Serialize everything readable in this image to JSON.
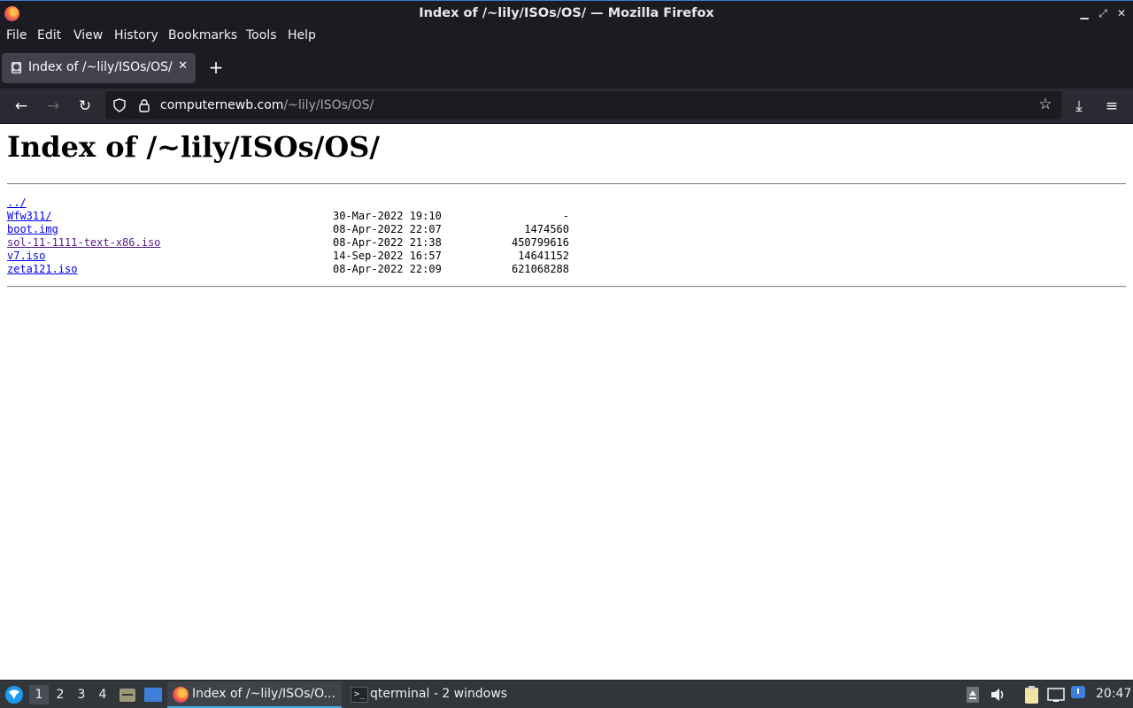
{
  "window": {
    "title": "Index of /~lily/ISOs/OS/ — Mozilla Firefox",
    "minimize": "▁",
    "restore": "⤢",
    "close": "✕"
  },
  "menu": [
    "File",
    "Edit",
    "View",
    "History",
    "Bookmarks",
    "Tools",
    "Help"
  ],
  "tab": {
    "label": "Index of /~lily/ISOs/OS/",
    "close": "✕",
    "new_tab": "+"
  },
  "nav": {
    "back": "←",
    "forward": "→",
    "reload": "↻",
    "url_domain": "computernewb.com",
    "url_path": "/~lily/ISOs/OS/",
    "bookmark": "☆",
    "downloads": "⤓",
    "menu": "≡"
  },
  "page": {
    "heading": "Index of /~lily/ISOs/OS/",
    "parent": "../",
    "entries": [
      {
        "name": "Wfw311/",
        "date": "30-Mar-2022 19:10",
        "size": "-",
        "visited": false
      },
      {
        "name": "boot.img",
        "date": "08-Apr-2022 22:07",
        "size": "1474560",
        "visited": false
      },
      {
        "name": "sol-11-1111-text-x86.iso",
        "date": "08-Apr-2022 21:38",
        "size": "450799616",
        "visited": true
      },
      {
        "name": "v7.iso",
        "date": "14-Sep-2022 16:57",
        "size": "14641152",
        "visited": false
      },
      {
        "name": "zeta121.iso",
        "date": "08-Apr-2022 22:09",
        "size": "621068288",
        "visited": false
      }
    ]
  },
  "taskbar": {
    "workspaces": [
      "1",
      "2",
      "3",
      "4"
    ],
    "tasks": [
      {
        "label": "Index of /~lily/ISOs/O...",
        "icon": "firefox-icon"
      },
      {
        "label": "qterminal - 2 windows",
        "icon": "terminal-icon"
      }
    ],
    "clock": "20:47"
  },
  "colors": {
    "chrome_dark": "#1c1b22",
    "navbar": "#2b2a33",
    "link": "#0000ee",
    "visited": "#551a8b",
    "accent": "#3daee9"
  }
}
